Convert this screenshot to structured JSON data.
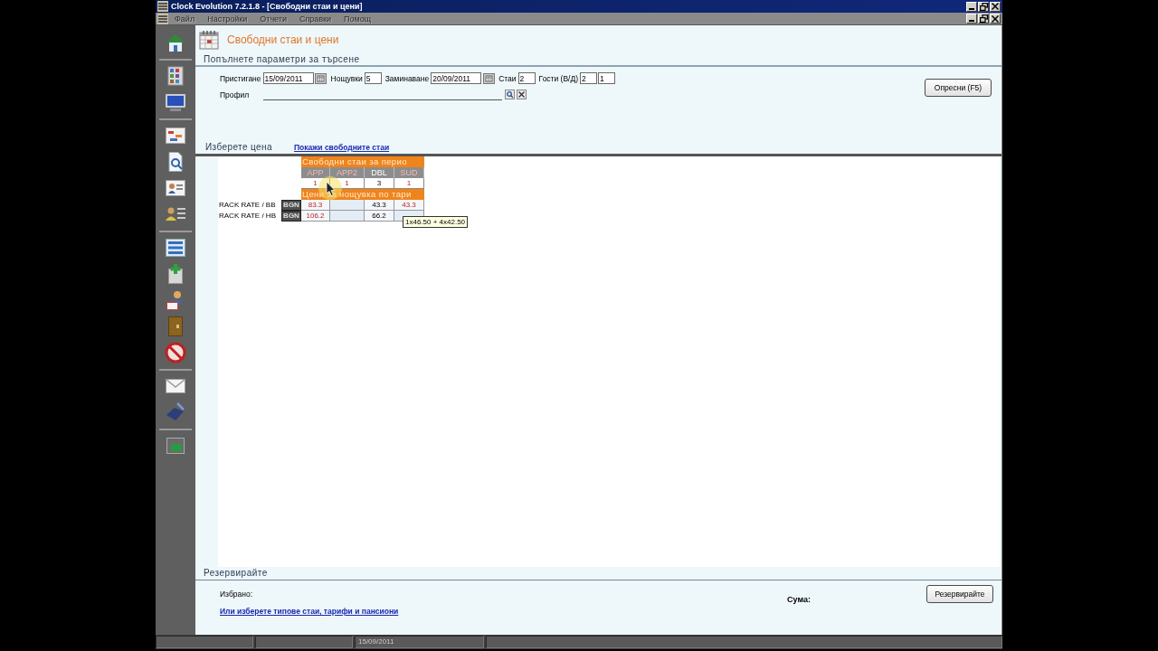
{
  "window": {
    "title": "Clock Evolution 7.2.1.8 - [Свободни стаи и цени]"
  },
  "menu": [
    {
      "label": "Файл",
      "disabled": true
    },
    {
      "label": "Настройки",
      "disabled": true
    },
    {
      "label": "Отчети",
      "disabled": true
    },
    {
      "label": "Справки",
      "disabled": true
    },
    {
      "label": "Помощ",
      "disabled": true
    }
  ],
  "page": {
    "title": "Свободни стаи и цени"
  },
  "search": {
    "heading": "Попълнете параметри за търсене",
    "fields": [
      {
        "kind": "date",
        "label": "Пристигане",
        "value": "15/09/2011"
      },
      {
        "kind": "number",
        "label": "Нощувки",
        "value": "5"
      },
      {
        "kind": "date",
        "label": "Заминаване",
        "value": "20/09/2011"
      },
      {
        "kind": "number",
        "label": "Стаи",
        "value": "2"
      },
      {
        "kind": "pair",
        "label": "Гости (В/Д)",
        "values": [
          "2",
          "1"
        ]
      }
    ],
    "profile_label": "Профил",
    "refresh_button": "Опресни (F5)"
  },
  "prices": {
    "heading": "Изберете цена",
    "link": "Покажи свободните стаи",
    "availability_title": "Свободни стаи за перио",
    "room_types": [
      {
        "code": "APP",
        "free": "1",
        "short": true
      },
      {
        "code": "APP2",
        "free": "1",
        "short": true
      },
      {
        "code": "DBL",
        "free": "3",
        "short": false
      },
      {
        "code": "SUD",
        "free": "1",
        "short": true
      }
    ],
    "rates_title": "Цени за нощувка по тари",
    "rates": [
      {
        "name": "RACK RATE / BB",
        "currency": "BGN",
        "prices": [
          {
            "kind": "price",
            "value": "83.3"
          },
          {
            "kind": "empty"
          },
          {
            "kind": "price",
            "value": "43.3"
          },
          {
            "kind": "price",
            "value": "43.3"
          }
        ]
      },
      {
        "name": "RACK RATE / HB",
        "currency": "BGN",
        "prices": [
          {
            "kind": "price",
            "value": "106.2"
          },
          {
            "kind": "empty"
          },
          {
            "kind": "price",
            "value": "66.2"
          },
          {
            "kind": "empty"
          }
        ]
      }
    ],
    "tooltip": "1x46.50 + 4x42.50"
  },
  "booking": {
    "heading": "Резервирайте",
    "selected_label": "Избрано:",
    "link": "Или изберете типове стаи, тарифи и пансиони",
    "sum_label": "Сума:",
    "button": "Резервирайте"
  },
  "status_bar": {
    "date": "15/09/2011"
  }
}
